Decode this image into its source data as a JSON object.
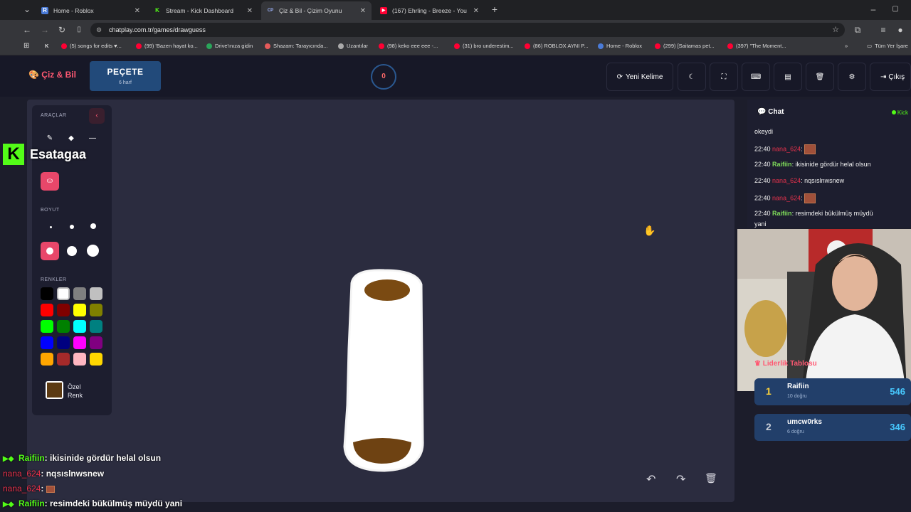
{
  "browser": {
    "tabs": [
      {
        "title": "Home - Roblox",
        "fav_color": "#4a7bd8",
        "fav": "R"
      },
      {
        "title": "Stream - Kick Dashboard",
        "fav_color": "#53fc18",
        "fav": "K"
      },
      {
        "title": "Çiz & Bil - Çizim Oyunu",
        "fav_color": "#35363a",
        "fav": "CP"
      },
      {
        "title": "(167) Ehrling - Breeze - You",
        "fav_color": "#ff0033",
        "fav": "▶"
      }
    ],
    "url": "chatplay.com.tr/games/drawguess",
    "bookmarks": [
      {
        "label": "(5) songs for edits ♥...",
        "color": "#ff0033"
      },
      {
        "label": "(99) 'Bazen hayat ko...",
        "color": "#ff0033"
      },
      {
        "label": "Drive'ınıza gidin",
        "color": "#2aa55a"
      },
      {
        "label": "Shazam: Tarayıcında...",
        "color": "#e55a5a"
      },
      {
        "label": "Uzantılar",
        "color": "#aaaaaa"
      },
      {
        "label": "(98) keko eee eee -...",
        "color": "#ff0033"
      },
      {
        "label": "(31) bro underestim...",
        "color": "#ff0033"
      },
      {
        "label": "(86) ROBLOX AYNI P...",
        "color": "#ff0033"
      },
      {
        "label": "Home - Roblox",
        "color": "#4a7bd8"
      },
      {
        "label": "(299) [Saitamas pet...",
        "color": "#ff0033"
      },
      {
        "label": "(397) \"The Moment...",
        "color": "#ff0033"
      }
    ],
    "all_bookmarks": "Tüm Yer İşare"
  },
  "header": {
    "logo": "Çiz & Bil",
    "word": "PEÇETE",
    "word_hint": "6 harf",
    "timer": "0",
    "new_word": "Yeni Kelime",
    "exit": "Çıkış"
  },
  "tools": {
    "title": "ARAÇLAR",
    "size_label": "BOYUT",
    "colors_label": "RENKLER",
    "custom_color_line1": "Özel",
    "custom_color_line2": "Renk",
    "custom_color": "#5c3a12",
    "palette": [
      "#000000",
      "#ffffff",
      "#808080",
      "#c0c0c0",
      "#ff0000",
      "#800000",
      "#ffff00",
      "#808000",
      "#00ff00",
      "#008000",
      "#00ffff",
      "#008080",
      "#0000ff",
      "#000080",
      "#ff00ff",
      "#800080",
      "#ffa500",
      "#a52a2a",
      "#ffb6c1",
      "#ffd700"
    ]
  },
  "chat": {
    "title": "Chat",
    "status": "Kick",
    "messages": [
      {
        "time": "",
        "user": "",
        "text": "okeydi",
        "type": "plain"
      },
      {
        "time": "22:40",
        "user": "nana_624",
        "text": ":",
        "type": "emote"
      },
      {
        "time": "22:40",
        "user": "Raifiin",
        "text": ": ikisinide gördür helal olsun",
        "type": "u1"
      },
      {
        "time": "22:40",
        "user": "nana_624",
        "text": ": nqsıslnwsnew",
        "type": "u2"
      },
      {
        "time": "22:40",
        "user": "nana_624",
        "text": ":",
        "type": "emote"
      },
      {
        "time": "22:40",
        "user": "Raifiin",
        "text": ": resimdeki bükülmüş müydü",
        "type": "u1"
      }
    ],
    "wrap_text": "yani"
  },
  "leaderboard": {
    "title": "Liderlik Tablosu",
    "rows": [
      {
        "rank": "1",
        "name": "Raifiin",
        "sub": "10 doğru",
        "score": "546",
        "rank_color": "#ffd43b"
      },
      {
        "rank": "2",
        "name": "umcw0rks",
        "sub": "6 doğru",
        "score": "346",
        "rank_color": "#c9ced8"
      }
    ]
  },
  "overlay": {
    "streamer": "Esatagaa",
    "lines": [
      {
        "user": "Raifiin",
        "text": ": ikisinide gördür helal olsun",
        "type": "u1"
      },
      {
        "user": "nana_624",
        "text": ": nqsıslnwsnew",
        "type": "u2"
      },
      {
        "user": "nana_624",
        "text": ":",
        "type": "emote"
      },
      {
        "user": "Raifiin",
        "text": ": resimdeki bükülmüş müydü yani",
        "type": "u1"
      }
    ]
  }
}
